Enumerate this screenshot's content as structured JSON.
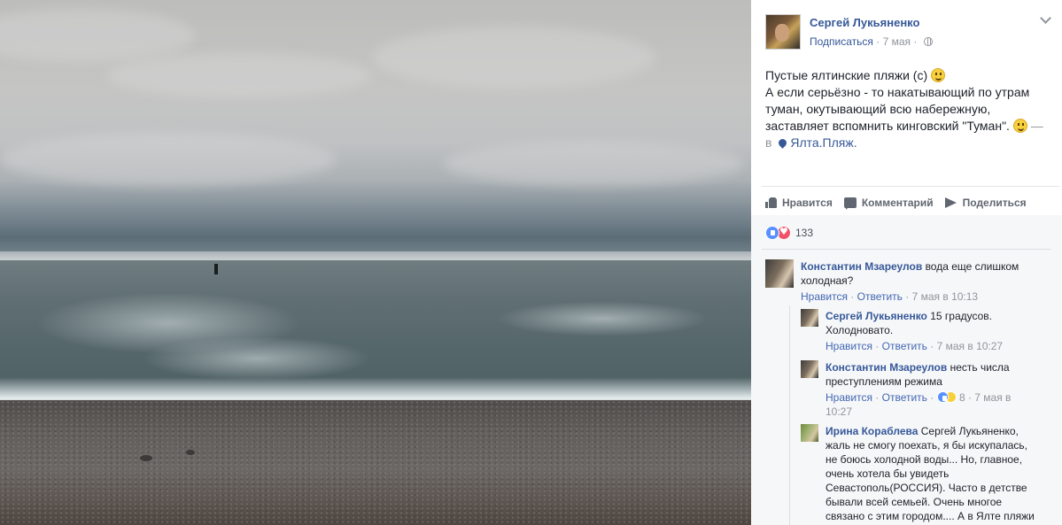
{
  "post": {
    "author": "Сергей Лукьяненко",
    "follow_label": "Подписаться",
    "meta_sep": " · ",
    "date": "7 мая",
    "meta_sep2": " · ",
    "text_line1": "Пустые ялтинские пляжи (с) ",
    "text_line2": "А если серьёзно - то накатывающий по утрам туман, окутывающий всю набережную, заставляет вспомнить кинговский \"Туман\". ",
    "dash": " —",
    "location_prefix": "в ",
    "location": "Ялта.Пляж."
  },
  "actions": {
    "like": "Нравится",
    "comment": "Комментарий",
    "share": "Поделиться"
  },
  "reactions": {
    "count": "133"
  },
  "comments": [
    {
      "author": "Константин Мзареулов",
      "text": " вода еще слишком холодная?",
      "like": "Нравится",
      "reply": "Ответить",
      "time": "7 мая в 10:13"
    },
    {
      "author": "Сергей Лукьяненко",
      "text": " 15 градусов. Холодновато.",
      "like": "Нравится",
      "reply": "Ответить",
      "time": "7 мая в 10:27"
    },
    {
      "author": "Константин Мзареулов",
      "text": " несть числа преступлениям режима",
      "like": "Нравится",
      "reply": "Ответить",
      "reaction_count": "8",
      "time": "7 мая в 10:27"
    },
    {
      "author": "Ирина Кораблева",
      "text": " Сергей Лукьяненко, жаль не смогу поехать, я бы искупалась, не боюсь холодной воды... Но, главное, очень хотела бы увидеть Севастополь(РОССИЯ). Часто в детстве бывали всей семьей. Очень многое связано с этим городом.... А в Ялте пляжи"
    }
  ],
  "ui": {
    "sep": " · "
  }
}
